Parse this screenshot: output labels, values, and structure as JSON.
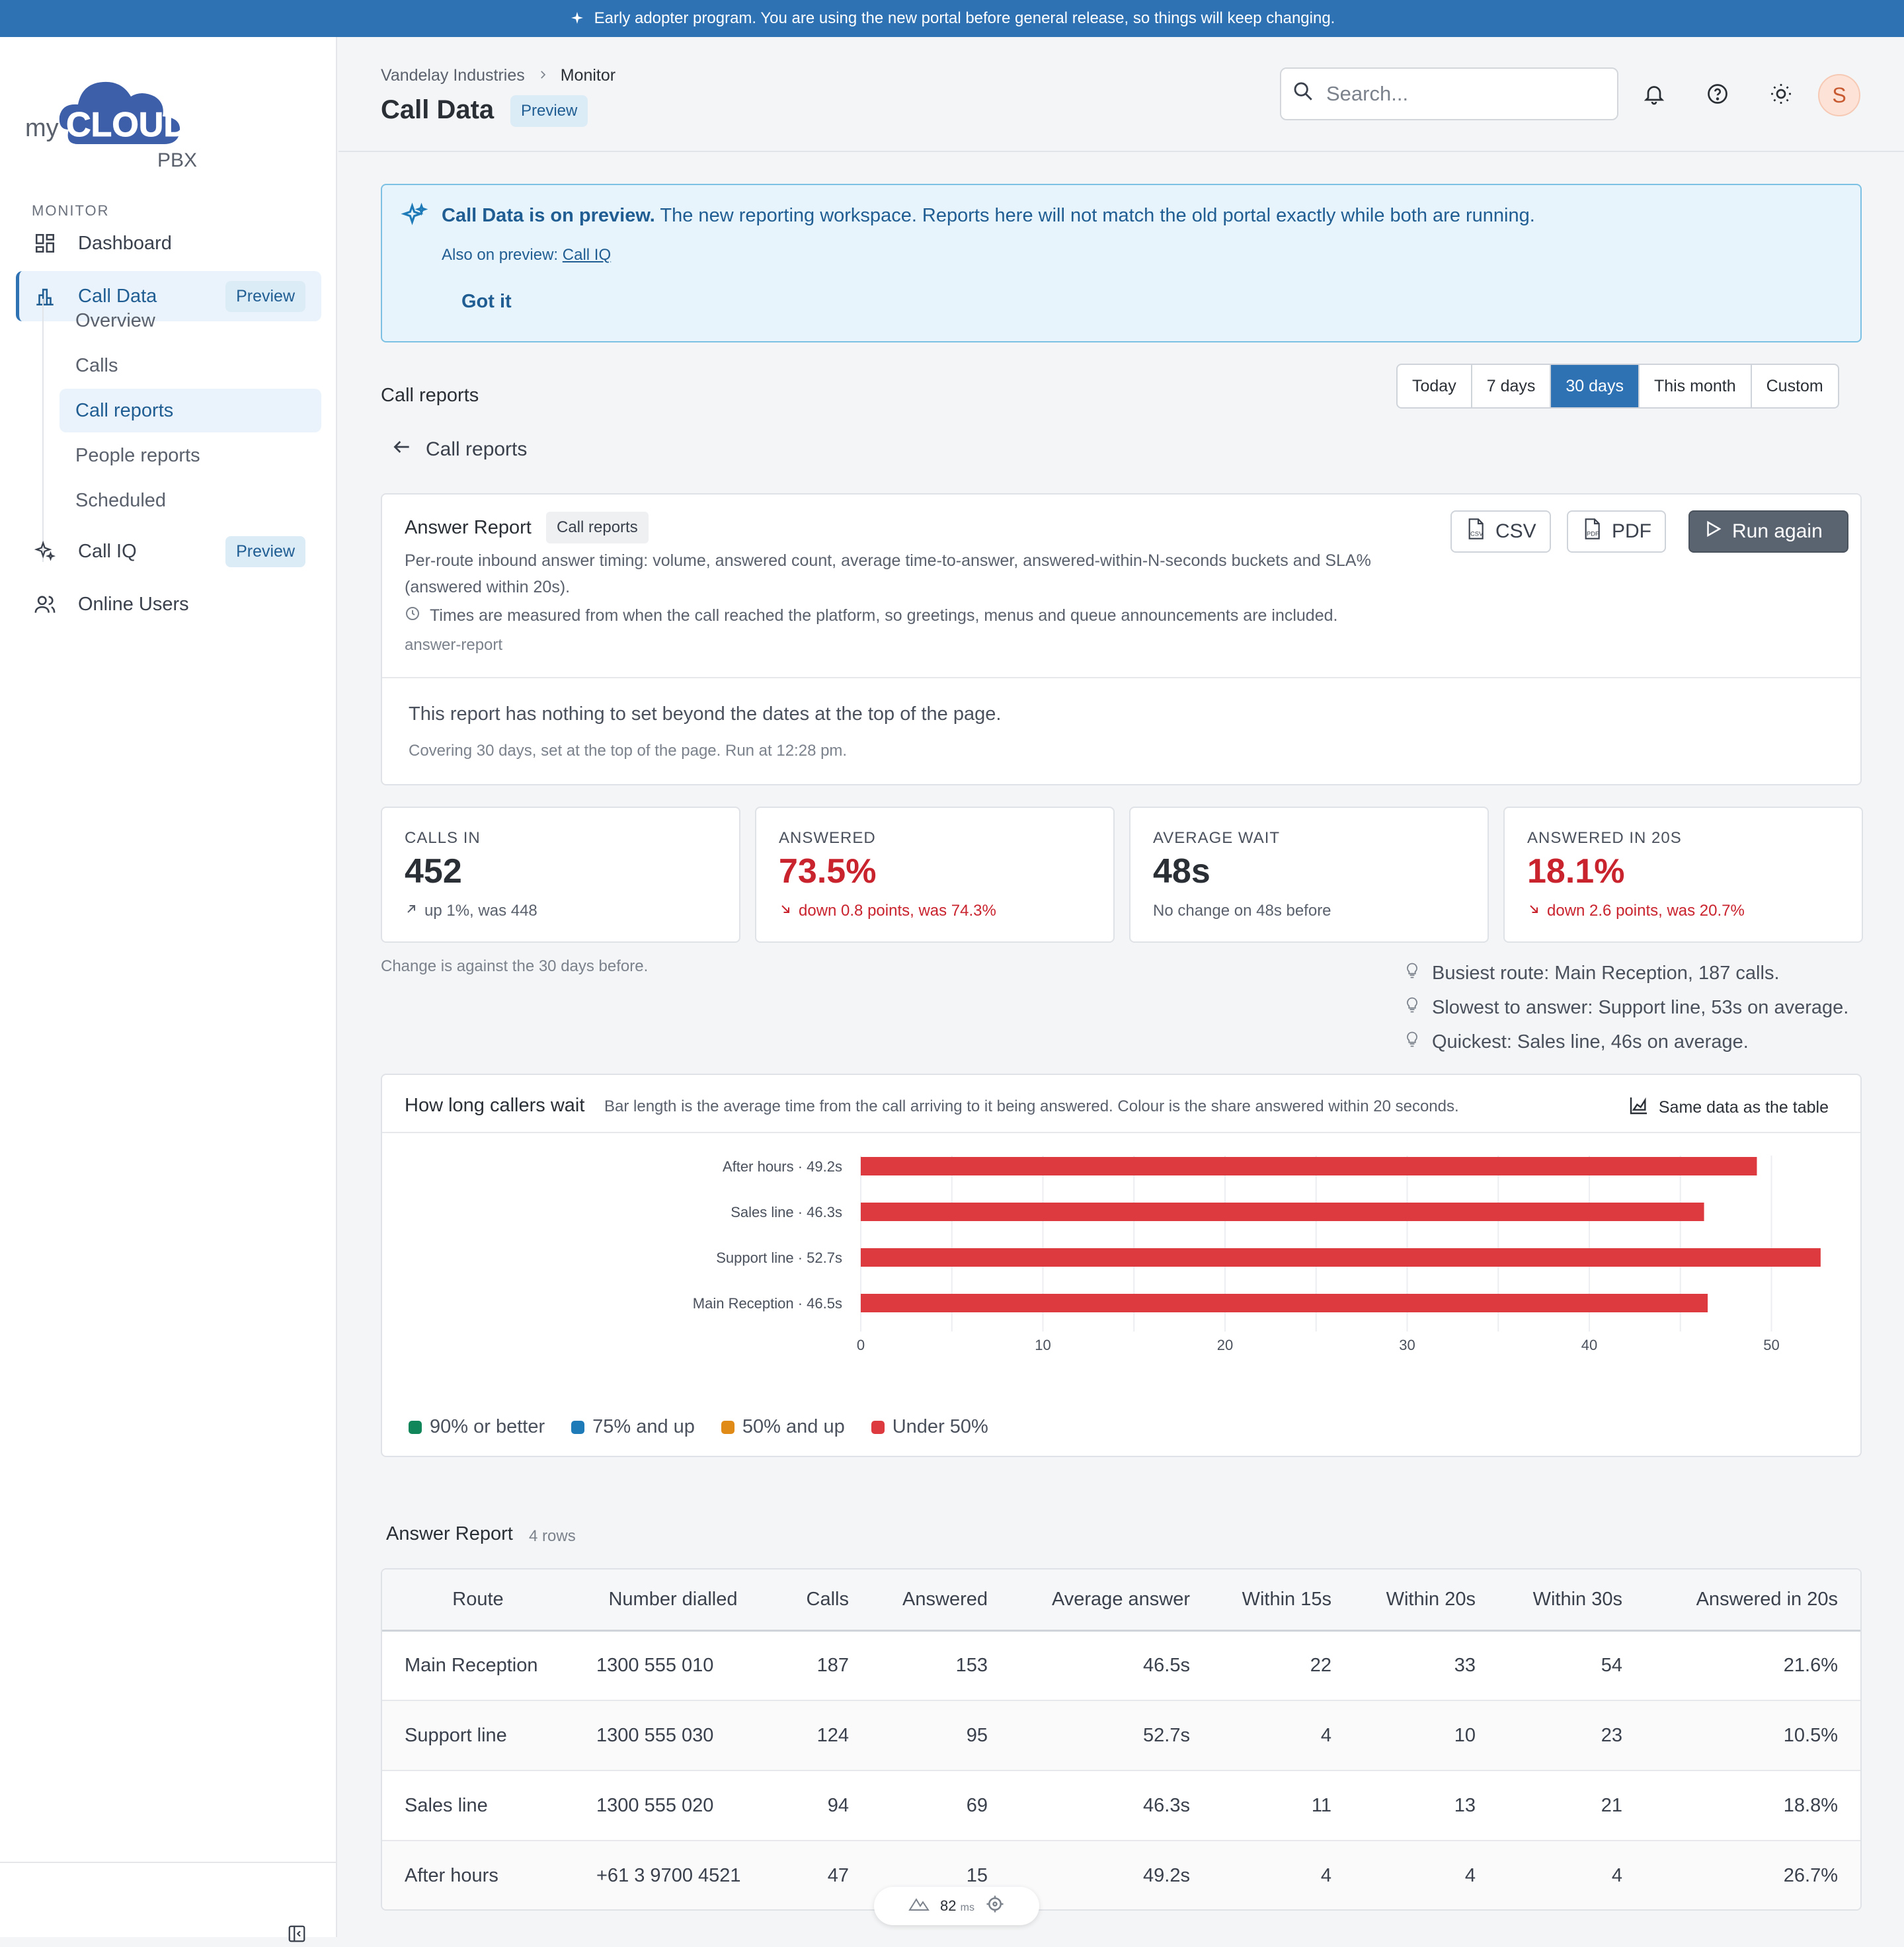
{
  "topbar": {
    "text": "Early adopter program. You are using the new portal before general release, so things will keep changing."
  },
  "logo": {
    "my": "my",
    "cloud": "CLOUD",
    "pbx": "PBX"
  },
  "sidebar": {
    "heading": "MONITOR",
    "items": [
      {
        "label": "Dashboard"
      },
      {
        "label": "Call Data",
        "badge": "Preview"
      },
      {
        "label": "Call IQ",
        "badge": "Preview"
      },
      {
        "label": "Online Users"
      }
    ],
    "sub_items": [
      {
        "label": "Overview"
      },
      {
        "label": "Calls"
      },
      {
        "label": "Call reports"
      },
      {
        "label": "People reports"
      },
      {
        "label": "Scheduled"
      }
    ]
  },
  "header": {
    "breadcrumb": [
      "Vandelay Industries",
      "Monitor"
    ],
    "title": "Call Data",
    "title_badge": "Preview",
    "search_placeholder": "Search...",
    "avatar_initial": "S"
  },
  "banner": {
    "title_bold": "Call Data is on preview.",
    "title_rest": " The new reporting workspace. Reports here will not match the old portal exactly while both are running.",
    "sub_prefix": "Also on preview: ",
    "sub_link": "Call IQ",
    "button": "Got it"
  },
  "section": {
    "label": "Call reports",
    "back_label": "Call reports"
  },
  "range": {
    "options": [
      "Today",
      "7 days",
      "30 days",
      "This month",
      "Custom"
    ],
    "selected": "30 days"
  },
  "report": {
    "title": "Answer Report",
    "tag": "Call reports",
    "description": "Per-route inbound answer timing: volume, answered count, average time-to-answer, answered-within-N-seconds buckets and SLA% (answered within 20s).",
    "note": "Times are measured from when the call reached the platform, so greetings, menus and queue announcements are included.",
    "slug": "answer-report",
    "csv": "CSV",
    "pdf": "PDF",
    "run": "Run again",
    "message": "This report has nothing to set beyond the dates at the top of the page.",
    "covering": "Covering 30 days, set at the top of the page. Run at 12:28 pm."
  },
  "kpis": [
    {
      "label": "CALLS IN",
      "value": "452",
      "change": "up 1%, was 448",
      "trend": "up"
    },
    {
      "label": "ANSWERED",
      "value": "73.5%",
      "change": "down 0.8 points, was 74.3%",
      "trend": "down"
    },
    {
      "label": "AVERAGE WAIT",
      "value": "48s",
      "change": "No change on 48s before",
      "trend": "flat"
    },
    {
      "label": "ANSWERED IN 20S",
      "value": "18.1%",
      "change": "down 2.6 points, was 20.7%",
      "trend": "down"
    }
  ],
  "change_note": "Change is against the 30 days before.",
  "insights": [
    "Busiest route: Main Reception, 187 calls.",
    "Slowest to answer: Support line, 53s on average.",
    "Quickest: Sales line, 46s on average."
  ],
  "chart": {
    "title": "How long callers wait",
    "subtitle": "Bar length is the average time from the call arriving to it being answered. Colour is the share answered within 20 seconds.",
    "link": "Same data as the table",
    "legend": [
      {
        "label": "90% or better",
        "color": "#10865a"
      },
      {
        "label": "75% and up",
        "color": "#1f7ab8"
      },
      {
        "label": "50% and up",
        "color": "#e08a17"
      },
      {
        "label": "Under 50%",
        "color": "#dc3a3f"
      }
    ]
  },
  "chart_data": {
    "type": "bar",
    "orientation": "horizontal",
    "categories": [
      "After hours · 49.2s",
      "Sales line · 46.3s",
      "Support line · 52.7s",
      "Main Reception · 46.5s"
    ],
    "values": [
      49.2,
      46.3,
      52.7,
      46.5
    ],
    "xticks": [
      0,
      10,
      20,
      30,
      40,
      50
    ],
    "xlim": [
      0,
      53
    ],
    "bar_color": "#dc3a3f",
    "grid": true
  },
  "table": {
    "title": "Answer Report",
    "count": "4 rows",
    "columns": [
      "Route",
      "Number dialled",
      "Calls",
      "Answered",
      "Average answer",
      "Within 15s",
      "Within 20s",
      "Within 30s",
      "Answered in 20s"
    ],
    "rows": [
      [
        "Main Reception",
        "1300 555 010",
        "187",
        "153",
        "46.5s",
        "22",
        "33",
        "54",
        "21.6%"
      ],
      [
        "Support line",
        "1300 555 030",
        "124",
        "95",
        "52.7s",
        "4",
        "10",
        "23",
        "10.5%"
      ],
      [
        "Sales line",
        "1300 555 020",
        "94",
        "69",
        "46.3s",
        "11",
        "13",
        "21",
        "18.8%"
      ],
      [
        "After hours",
        "+61 3 9700 4521",
        "47",
        "15",
        "49.2s",
        "4",
        "4",
        "4",
        "26.7%"
      ]
    ]
  },
  "devtools": {
    "ms_value": "82",
    "ms_unit": "ms"
  }
}
